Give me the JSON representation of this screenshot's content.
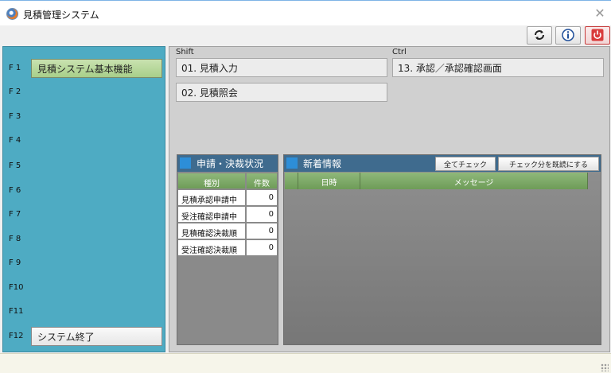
{
  "window": {
    "title": "見積管理システム"
  },
  "toolbar": {
    "refresh_icon": "refresh-icon",
    "info_icon": "info-icon",
    "power_icon": "power-icon",
    "accent_color": "#c73a3a"
  },
  "sidebar": {
    "color": "#4eabc3",
    "items": [
      {
        "key": "F 1",
        "label": "見積システム基本機能"
      },
      {
        "key": "F 2",
        "label": ""
      },
      {
        "key": "F 3",
        "label": ""
      },
      {
        "key": "F 4",
        "label": ""
      },
      {
        "key": "F 5",
        "label": ""
      },
      {
        "key": "F 6",
        "label": ""
      },
      {
        "key": "F 7",
        "label": ""
      },
      {
        "key": "F 8",
        "label": ""
      },
      {
        "key": "F 9",
        "label": ""
      },
      {
        "key": "F10",
        "label": ""
      },
      {
        "key": "F11",
        "label": ""
      },
      {
        "key": "F12",
        "label": "システム終了"
      }
    ]
  },
  "menu": {
    "shift_label": "Shift",
    "ctrl_label": "Ctrl",
    "shift_items": [
      "01. 見積入力",
      "02. 見積照会"
    ],
    "ctrl_items": [
      "13. 承認／承認確認画面"
    ]
  },
  "status_panel": {
    "title": "申請・決裁状況",
    "headers": [
      "種別",
      "件数"
    ],
    "rows": [
      {
        "type": "見積承認申請中",
        "count": "0"
      },
      {
        "type": "受注確認申請中",
        "count": "0"
      },
      {
        "type": "見積確認決裁順",
        "count": "0"
      },
      {
        "type": "受注確認決裁順",
        "count": "0"
      }
    ]
  },
  "news_panel": {
    "title": "新着情報",
    "check_all_label": "全てチェック",
    "mark_read_label": "チェック分を既読にする",
    "headers": [
      "日時",
      "メッセージ"
    ]
  }
}
